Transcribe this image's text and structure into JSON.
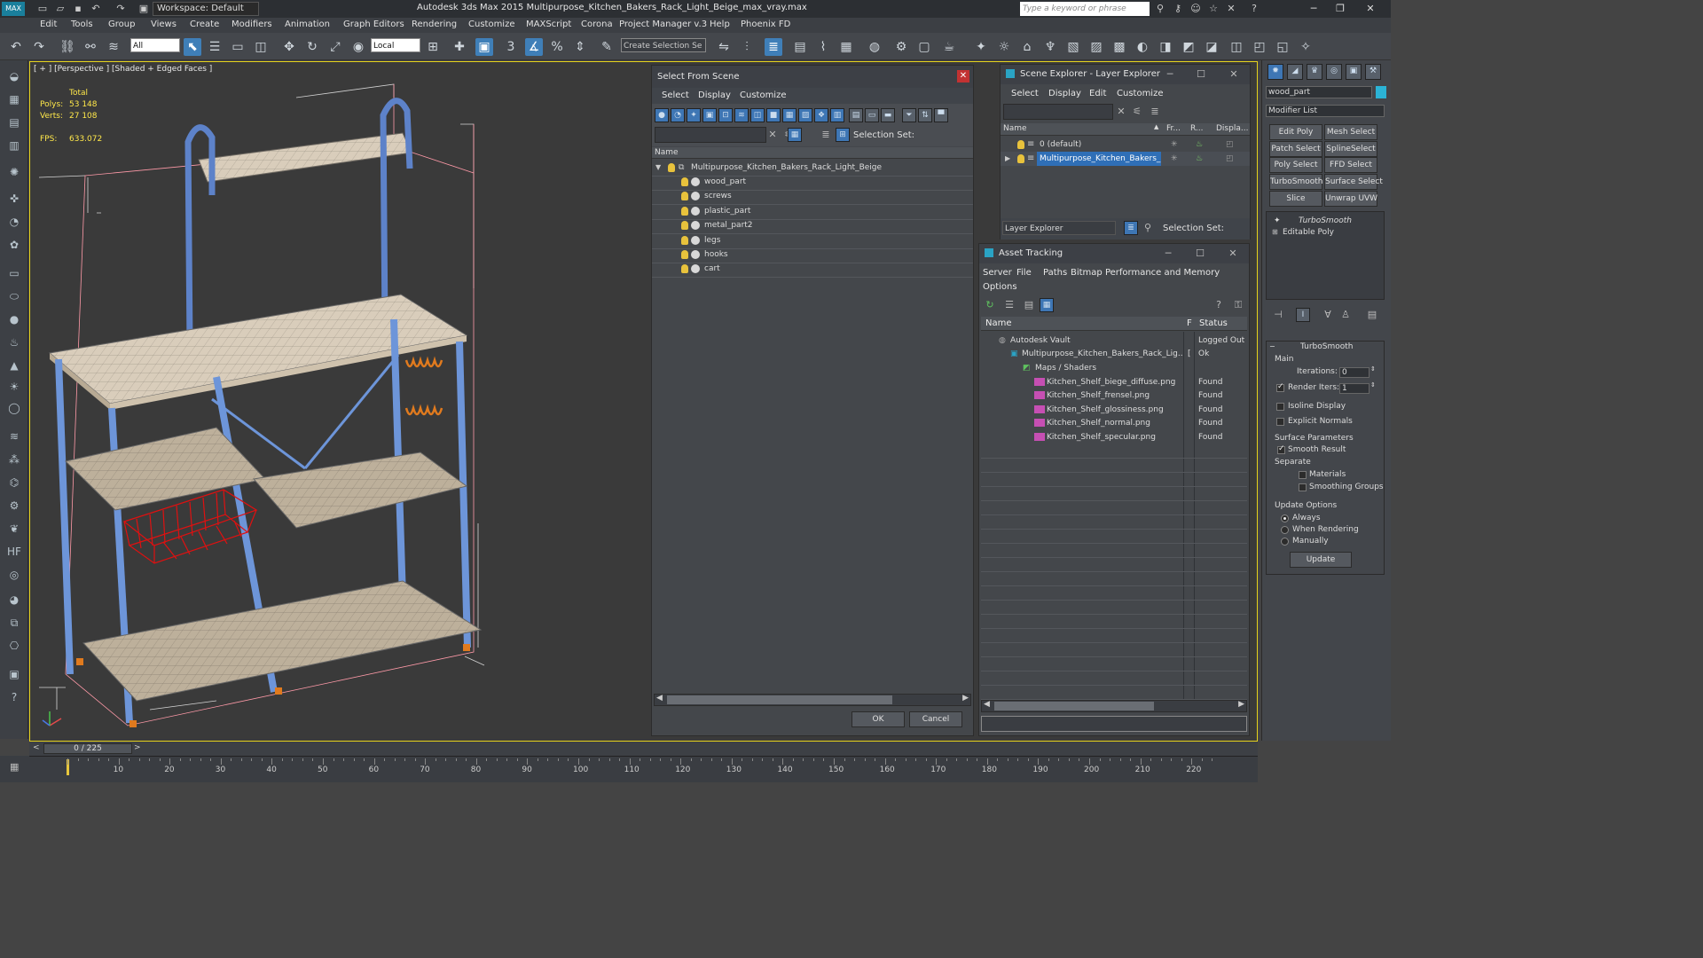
{
  "titlebar": {
    "title": "Autodesk 3ds Max  2015     Multipurpose_Kitchen_Bakers_Rack_Light_Beige_max_vray.max",
    "workspace": "Workspace: Default",
    "search_placeholder": "Type a keyword or phrase",
    "logo": "MAX"
  },
  "menubar": [
    "Edit",
    "Tools",
    "Group",
    "Views",
    "Create",
    "Modifiers",
    "Animation",
    "Graph Editors",
    "Rendering",
    "Customize",
    "MAXScript",
    "Corona",
    "Project Manager v.3",
    "Help",
    "Phoenix FD"
  ],
  "toolbar": {
    "filter": "All",
    "ref_coord": "Local",
    "selection_set_placeholder": "Create Selection Se",
    "snap_3": "3",
    "snap_pct": "%"
  },
  "viewport": {
    "label": "[ + ] [Perspective ] [Shaded + Edged Faces ]",
    "stats_total": "Total",
    "polys_label": "Polys:",
    "polys_value": "53 148",
    "verts_label": "Verts:",
    "verts_value": "27 108",
    "fps_label": "FPS:",
    "fps_value": "633.072"
  },
  "select_from_scene": {
    "title": "Select From Scene",
    "menus": [
      "Select",
      "Display",
      "Customize"
    ],
    "selection_set_label": "Selection Set:",
    "col_name": "Name",
    "root": "Multipurpose_Kitchen_Bakers_Rack_Light_Beige",
    "children": [
      "wood_part",
      "screws",
      "plastic_part",
      "metal_part2",
      "legs",
      "hooks",
      "cart"
    ],
    "ok": "OK",
    "cancel": "Cancel"
  },
  "scene_explorer": {
    "title": "Scene Explorer - Layer Explorer",
    "menus": [
      "Select",
      "Display",
      "Edit",
      "Customize"
    ],
    "cols": [
      "Name",
      "Fr...",
      "R...",
      "Displa..."
    ],
    "rows": [
      "0 (default)",
      "Multipurpose_Kitchen_Bakers_R..."
    ],
    "layer_explorer": "Layer Explorer",
    "selection_set_label": "Selection Set:"
  },
  "asset_tracking": {
    "title": "Asset Tracking",
    "menus": [
      "Server",
      "File",
      "Paths",
      "Bitmap Performance and Memory",
      "Options"
    ],
    "cols": [
      "Name",
      "F",
      "Status"
    ],
    "rows": [
      {
        "name": "Autodesk Vault",
        "f": "",
        "status": "Logged Out"
      },
      {
        "name": "Multipurpose_Kitchen_Bakers_Rack_Lig...",
        "f": "[",
        "status": "Ok"
      },
      {
        "name": "Maps / Shaders",
        "f": "",
        "status": ""
      },
      {
        "name": "Kitchen_Shelf_biege_diffuse.png",
        "f": "",
        "status": "Found"
      },
      {
        "name": "Kitchen_Shelf_frensel.png",
        "f": "",
        "status": "Found"
      },
      {
        "name": "Kitchen_Shelf_glossiness.png",
        "f": "",
        "status": "Found"
      },
      {
        "name": "Kitchen_Shelf_normal.png",
        "f": "",
        "status": "Found"
      },
      {
        "name": "Kitchen_Shelf_specular.png",
        "f": "",
        "status": "Found"
      }
    ]
  },
  "command_panel": {
    "object_name": "wood_part",
    "modifier_list": "Modifier List",
    "buttons": [
      "Edit Poly",
      "Mesh Select",
      "Patch Select",
      "SplineSelect",
      "Poly Select",
      "FFD Select",
      "TurboSmooth",
      "Surface Select",
      "Slice",
      "Unwrap UVW"
    ],
    "stack": [
      "TurboSmooth",
      "Editable Poly"
    ],
    "rollout_title": "TurboSmooth",
    "main": "Main",
    "iterations_label": "Iterations:",
    "iterations_value": "0",
    "render_iters_label": "Render Iters:",
    "render_iters_value": "1",
    "isoline": "Isoline Display",
    "explicit": "Explicit Normals",
    "surface_params": "Surface Parameters",
    "smooth_result": "Smooth Result",
    "separate": "Separate",
    "materials": "Materials",
    "smoothing_groups": "Smoothing Groups",
    "update_options": "Update Options",
    "always": "Always",
    "when_rendering": "When Rendering",
    "manually": "Manually",
    "update": "Update"
  },
  "timeline": {
    "frame": "0 / 225",
    "ticks": [
      "10",
      "20",
      "30",
      "40",
      "50",
      "60",
      "70",
      "80",
      "90",
      "100",
      "110",
      "120",
      "130",
      "140",
      "150",
      "160",
      "170",
      "180",
      "190",
      "200",
      "210",
      "220"
    ]
  },
  "colors": {
    "accent": "#3f7fb8",
    "viewport_border": "#e6d31b",
    "stats": "#ffe84a"
  }
}
